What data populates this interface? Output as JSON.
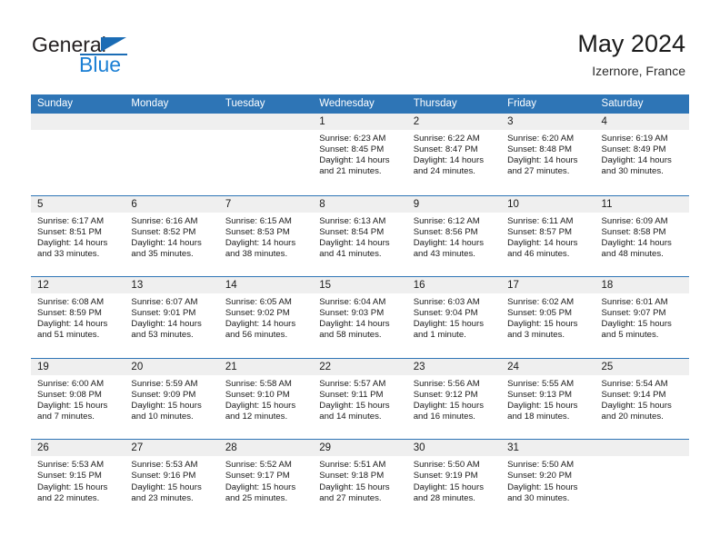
{
  "brand": {
    "name_part1": "General",
    "name_part2": "Blue",
    "triangle_color": "#1b6cb5",
    "blue_color": "#1b7fd4"
  },
  "header": {
    "title": "May 2024",
    "subtitle": "Izernore, France"
  },
  "theme": {
    "header_blue": "#2e75b6",
    "row_band_gray": "#efefef",
    "text_color": "#1a1a1a"
  },
  "calendar": {
    "day_headers": [
      "Sunday",
      "Monday",
      "Tuesday",
      "Wednesday",
      "Thursday",
      "Friday",
      "Saturday"
    ],
    "weeks": [
      [
        {
          "day": "",
          "info": ""
        },
        {
          "day": "",
          "info": ""
        },
        {
          "day": "",
          "info": ""
        },
        {
          "day": "1",
          "info": "Sunrise: 6:23 AM\nSunset: 8:45 PM\nDaylight: 14 hours\nand 21 minutes."
        },
        {
          "day": "2",
          "info": "Sunrise: 6:22 AM\nSunset: 8:47 PM\nDaylight: 14 hours\nand 24 minutes."
        },
        {
          "day": "3",
          "info": "Sunrise: 6:20 AM\nSunset: 8:48 PM\nDaylight: 14 hours\nand 27 minutes."
        },
        {
          "day": "4",
          "info": "Sunrise: 6:19 AM\nSunset: 8:49 PM\nDaylight: 14 hours\nand 30 minutes."
        }
      ],
      [
        {
          "day": "5",
          "info": "Sunrise: 6:17 AM\nSunset: 8:51 PM\nDaylight: 14 hours\nand 33 minutes."
        },
        {
          "day": "6",
          "info": "Sunrise: 6:16 AM\nSunset: 8:52 PM\nDaylight: 14 hours\nand 35 minutes."
        },
        {
          "day": "7",
          "info": "Sunrise: 6:15 AM\nSunset: 8:53 PM\nDaylight: 14 hours\nand 38 minutes."
        },
        {
          "day": "8",
          "info": "Sunrise: 6:13 AM\nSunset: 8:54 PM\nDaylight: 14 hours\nand 41 minutes."
        },
        {
          "day": "9",
          "info": "Sunrise: 6:12 AM\nSunset: 8:56 PM\nDaylight: 14 hours\nand 43 minutes."
        },
        {
          "day": "10",
          "info": "Sunrise: 6:11 AM\nSunset: 8:57 PM\nDaylight: 14 hours\nand 46 minutes."
        },
        {
          "day": "11",
          "info": "Sunrise: 6:09 AM\nSunset: 8:58 PM\nDaylight: 14 hours\nand 48 minutes."
        }
      ],
      [
        {
          "day": "12",
          "info": "Sunrise: 6:08 AM\nSunset: 8:59 PM\nDaylight: 14 hours\nand 51 minutes."
        },
        {
          "day": "13",
          "info": "Sunrise: 6:07 AM\nSunset: 9:01 PM\nDaylight: 14 hours\nand 53 minutes."
        },
        {
          "day": "14",
          "info": "Sunrise: 6:05 AM\nSunset: 9:02 PM\nDaylight: 14 hours\nand 56 minutes."
        },
        {
          "day": "15",
          "info": "Sunrise: 6:04 AM\nSunset: 9:03 PM\nDaylight: 14 hours\nand 58 minutes."
        },
        {
          "day": "16",
          "info": "Sunrise: 6:03 AM\nSunset: 9:04 PM\nDaylight: 15 hours\nand 1 minute."
        },
        {
          "day": "17",
          "info": "Sunrise: 6:02 AM\nSunset: 9:05 PM\nDaylight: 15 hours\nand 3 minutes."
        },
        {
          "day": "18",
          "info": "Sunrise: 6:01 AM\nSunset: 9:07 PM\nDaylight: 15 hours\nand 5 minutes."
        }
      ],
      [
        {
          "day": "19",
          "info": "Sunrise: 6:00 AM\nSunset: 9:08 PM\nDaylight: 15 hours\nand 7 minutes."
        },
        {
          "day": "20",
          "info": "Sunrise: 5:59 AM\nSunset: 9:09 PM\nDaylight: 15 hours\nand 10 minutes."
        },
        {
          "day": "21",
          "info": "Sunrise: 5:58 AM\nSunset: 9:10 PM\nDaylight: 15 hours\nand 12 minutes."
        },
        {
          "day": "22",
          "info": "Sunrise: 5:57 AM\nSunset: 9:11 PM\nDaylight: 15 hours\nand 14 minutes."
        },
        {
          "day": "23",
          "info": "Sunrise: 5:56 AM\nSunset: 9:12 PM\nDaylight: 15 hours\nand 16 minutes."
        },
        {
          "day": "24",
          "info": "Sunrise: 5:55 AM\nSunset: 9:13 PM\nDaylight: 15 hours\nand 18 minutes."
        },
        {
          "day": "25",
          "info": "Sunrise: 5:54 AM\nSunset: 9:14 PM\nDaylight: 15 hours\nand 20 minutes."
        }
      ],
      [
        {
          "day": "26",
          "info": "Sunrise: 5:53 AM\nSunset: 9:15 PM\nDaylight: 15 hours\nand 22 minutes."
        },
        {
          "day": "27",
          "info": "Sunrise: 5:53 AM\nSunset: 9:16 PM\nDaylight: 15 hours\nand 23 minutes."
        },
        {
          "day": "28",
          "info": "Sunrise: 5:52 AM\nSunset: 9:17 PM\nDaylight: 15 hours\nand 25 minutes."
        },
        {
          "day": "29",
          "info": "Sunrise: 5:51 AM\nSunset: 9:18 PM\nDaylight: 15 hours\nand 27 minutes."
        },
        {
          "day": "30",
          "info": "Sunrise: 5:50 AM\nSunset: 9:19 PM\nDaylight: 15 hours\nand 28 minutes."
        },
        {
          "day": "31",
          "info": "Sunrise: 5:50 AM\nSunset: 9:20 PM\nDaylight: 15 hours\nand 30 minutes."
        },
        {
          "day": "",
          "info": ""
        }
      ]
    ]
  }
}
